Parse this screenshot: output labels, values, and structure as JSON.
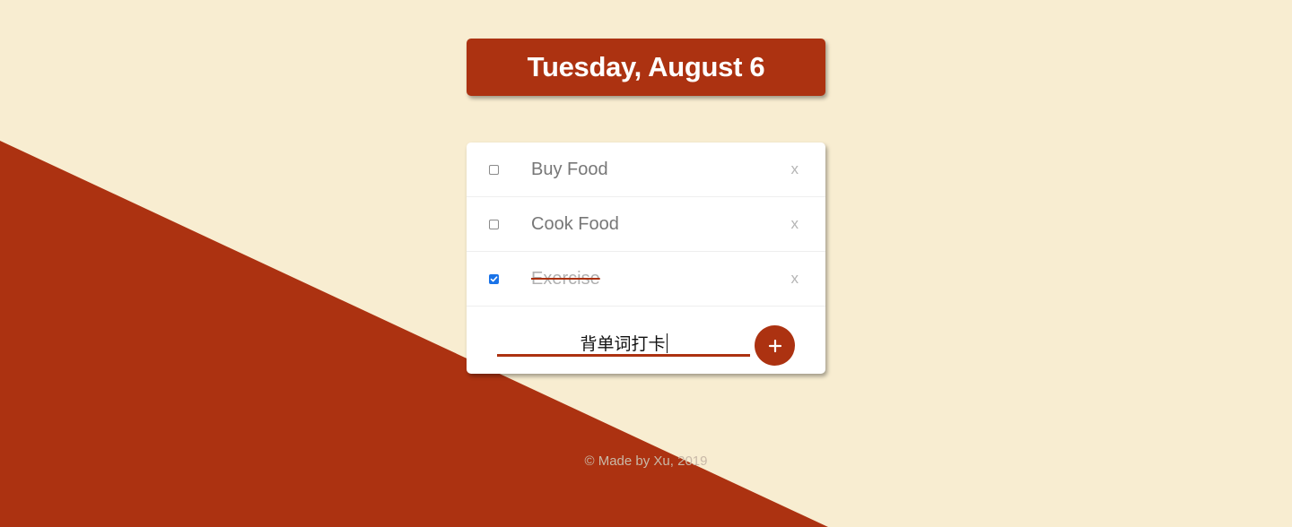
{
  "colors": {
    "background": "#f8edd1",
    "accent": "#ac3211"
  },
  "heading": {
    "title": "Tuesday, August 6"
  },
  "todos": [
    {
      "label": "Buy Food",
      "checked": false,
      "delete_label": "x"
    },
    {
      "label": "Cook Food",
      "checked": false,
      "delete_label": "x"
    },
    {
      "label": "Exercise",
      "checked": true,
      "delete_label": "x"
    }
  ],
  "new_item": {
    "value": "背单词打卡",
    "add_icon": "plus-icon"
  },
  "footer": {
    "text": "© Made by Xu, 2019"
  }
}
